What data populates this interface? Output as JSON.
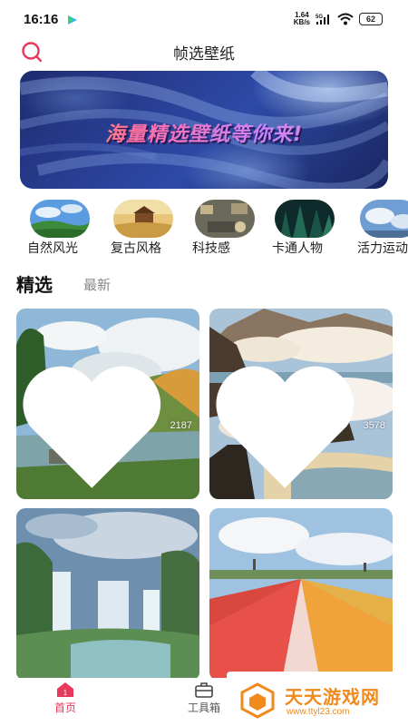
{
  "status_bar": {
    "time": "16:16",
    "net_speed_value": "1.64",
    "net_speed_unit": "KB/s",
    "network_type": "5G",
    "battery": "62"
  },
  "header": {
    "title": "帧选壁纸",
    "search_icon": "search-icon"
  },
  "banner": {
    "text": "海量精选壁纸等你来!"
  },
  "categories": [
    {
      "label": "自然风光"
    },
    {
      "label": "复古风格"
    },
    {
      "label": "科技感"
    },
    {
      "label": "卡通人物"
    },
    {
      "label": "活力运动"
    }
  ],
  "section_tabs": {
    "featured": "精选",
    "latest": "最新"
  },
  "wallpapers": [
    {
      "scene": "cottage by pond",
      "likes": "2187"
    },
    {
      "scene": "cliffs above clouds",
      "likes": "3578"
    },
    {
      "scene": "waterfalls",
      "likes": ""
    },
    {
      "scene": "tulip field with windmills",
      "likes": ""
    }
  ],
  "bottom_nav": {
    "home_label": "首页",
    "tools_label": "工具箱",
    "home_badge": "1"
  },
  "watermark": {
    "title": "天天游戏网",
    "url": "www.ttyl23.com"
  },
  "colors": {
    "accent": "#e8385b",
    "watermark": "#f08a1c",
    "banner": "#23378a"
  }
}
